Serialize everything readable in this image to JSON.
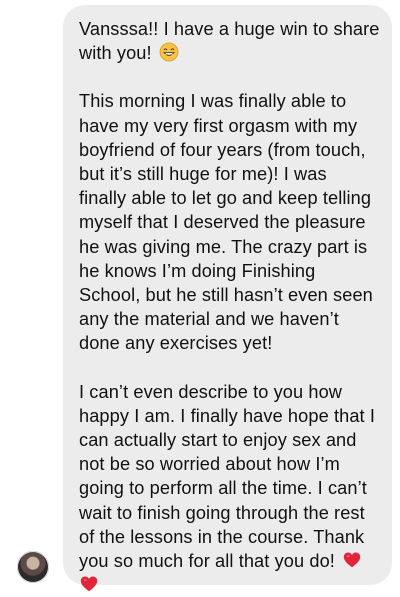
{
  "message": {
    "paragraphs": [
      {
        "lines": [
          "Vansssa!! I have a huge win to share",
          "with you!"
        ]
      },
      {
        "lines": [
          "This morning I was finally able to",
          "have my very first orgasm with my",
          "boyfriend of four years (from touch,",
          "but it’s still huge for me)! I was",
          "finally able to let go and keep telling",
          "myself that I deserved the pleasure",
          "he was giving me. The crazy part is",
          "he knows I’m doing Finishing",
          "School, but he still hasn’t even seen",
          "any the material and we haven’t",
          "done any exercises yet!"
        ]
      },
      {
        "lines": [
          "I can’t even describe to you how",
          "happy I am. I finally have hope that I",
          "can actually start to enjoy sex and",
          "not be so worried about how I’m",
          "going to perform all the time. I can’t",
          "wait to finish going through the rest",
          "of the lessons in the course. Thank",
          "you so much for all that you do!"
        ]
      }
    ],
    "emojis": {
      "grin": "grinning-face-icon",
      "heart": "red-heart-icon"
    }
  },
  "colors": {
    "bubble": "#ececed",
    "text": "#111111",
    "heart": "#e0243a",
    "emoji_face": "#f7c340"
  }
}
